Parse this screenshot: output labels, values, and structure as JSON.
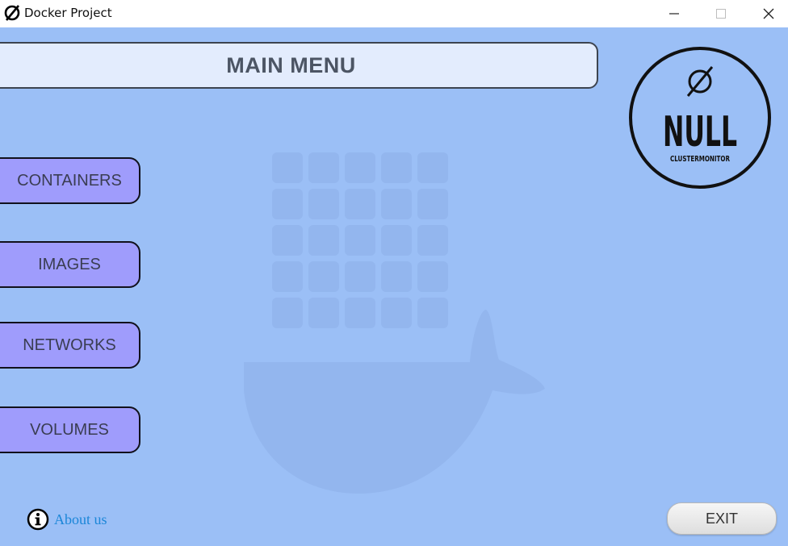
{
  "window": {
    "title": "Docker Project",
    "icon": "null-slash-icon"
  },
  "titlebar_controls": {
    "minimize": "minimize-icon",
    "maximize": "maximize-icon",
    "close": "close-icon"
  },
  "header": {
    "title": "MAIN MENU"
  },
  "menu": [
    {
      "label": "CONTAINERS"
    },
    {
      "label": "IMAGES"
    },
    {
      "label": "NETWORKS"
    },
    {
      "label": "VOLUMES"
    }
  ],
  "logo": {
    "word": "NULL",
    "subtitle": "CLUSTERMONITOR"
  },
  "footer": {
    "about_label": "About us",
    "exit_label": "EXIT"
  },
  "colors": {
    "background": "#9bbff6",
    "menu_button": "#9f9cfc",
    "header_bg": "#e3ecfd",
    "link": "#1b86d8"
  }
}
